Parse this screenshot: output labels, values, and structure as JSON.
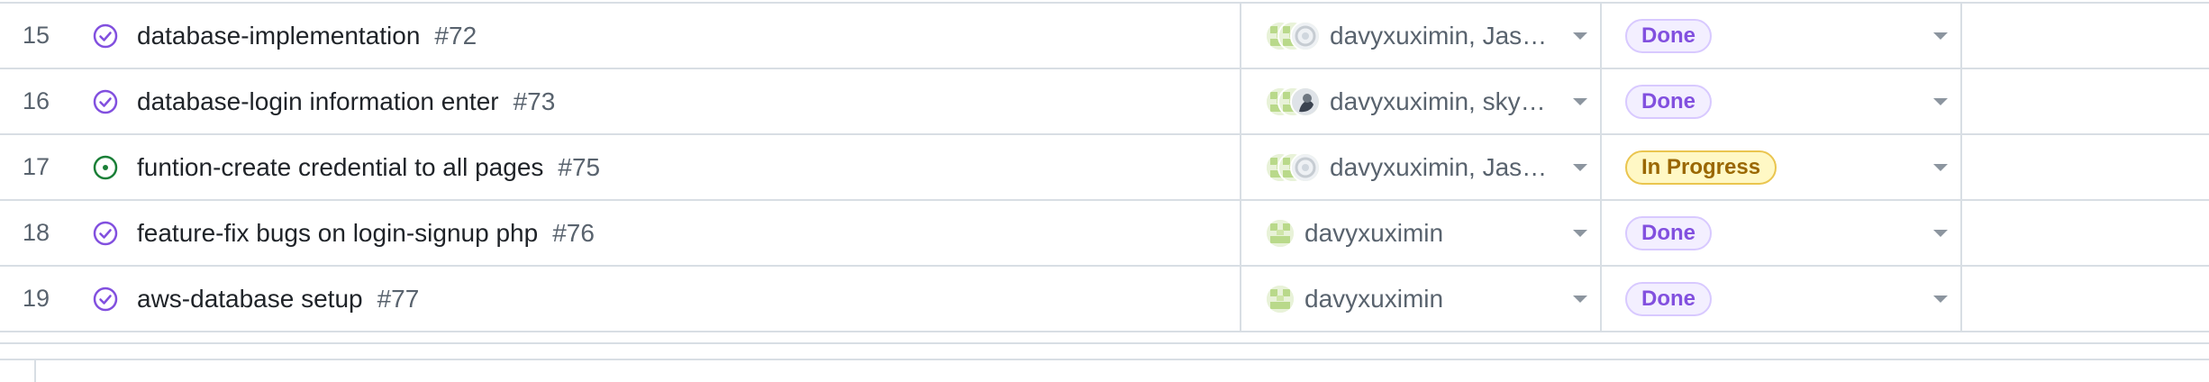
{
  "rows": [
    {
      "num": "15",
      "title": "database-implementation",
      "issue": "#72",
      "state": "closed",
      "assignees": "davyxuximin, Jas…",
      "avatars": [
        "green",
        "green",
        "gray"
      ],
      "status": "Done"
    },
    {
      "num": "16",
      "title": "database-login information enter",
      "issue": "#73",
      "state": "closed",
      "assignees": "davyxuximin, sky…",
      "avatars": [
        "green",
        "green",
        "dark"
      ],
      "status": "Done"
    },
    {
      "num": "17",
      "title": "funtion-create credential to all pages",
      "issue": "#75",
      "state": "open",
      "assignees": "davyxuximin, Jas…",
      "avatars": [
        "green",
        "green",
        "gray"
      ],
      "status": "In Progress"
    },
    {
      "num": "18",
      "title": "feature-fix bugs on login-signup php",
      "issue": "#76",
      "state": "closed",
      "assignees": "davyxuximin",
      "avatars": [
        "green"
      ],
      "status": "Done"
    },
    {
      "num": "19",
      "title": "aws-database setup",
      "issue": "#77",
      "state": "closed",
      "assignees": "davyxuximin",
      "avatars": [
        "green"
      ],
      "status": "Done"
    }
  ],
  "icons": {
    "closed": "check-circle-icon",
    "open": "dot-circle-icon",
    "caret": "caret-down-icon"
  },
  "colors": {
    "closed": "#8250df",
    "open": "#1a7f37",
    "done_bg": "#f3efff",
    "progress_bg": "#fff8c5"
  }
}
